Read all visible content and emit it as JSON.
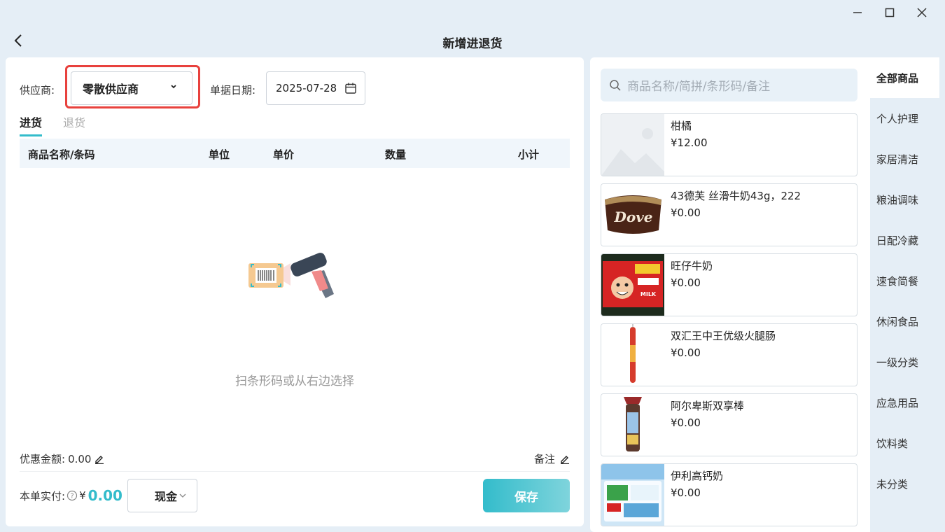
{
  "header": {
    "title": "新增进退货"
  },
  "form": {
    "supplier_label": "供应商:",
    "supplier_value": "零散供应商",
    "date_label": "单据日期:",
    "date_value": "2025-07-28"
  },
  "tabs": [
    {
      "label": "进货",
      "active": true
    },
    {
      "label": "退货",
      "active": false
    }
  ],
  "table": {
    "columns": [
      "商品名称/条码",
      "单位",
      "单价",
      "数量",
      "小计"
    ],
    "empty_text": "扫条形码或从右边选择"
  },
  "footer": {
    "discount_label": "优惠金额:",
    "discount_value": "0.00",
    "remark_label": "备注",
    "paid_label": "本单实付:",
    "currency": "¥",
    "paid_amount": "0.00",
    "payment_method": "现金",
    "save_label": "保存"
  },
  "search": {
    "placeholder": "商品名称/简拼/条形码/备注"
  },
  "products": [
    {
      "name": "柑橘",
      "price": "¥12.00"
    },
    {
      "name": "43德芙 丝滑牛奶43g，222",
      "price": "¥0.00"
    },
    {
      "name": "旺仔牛奶",
      "price": "¥0.00"
    },
    {
      "name": "双汇王中王优级火腿肠",
      "price": "¥0.00"
    },
    {
      "name": "阿尔卑斯双享棒",
      "price": "¥0.00"
    },
    {
      "name": "伊利高钙奶",
      "price": "¥0.00"
    }
  ],
  "categories": [
    {
      "label": "全部商品",
      "active": true
    },
    {
      "label": "个人护理"
    },
    {
      "label": "家居清洁"
    },
    {
      "label": "粮油调味"
    },
    {
      "label": "日配冷藏"
    },
    {
      "label": "速食简餐"
    },
    {
      "label": "休闲食品"
    },
    {
      "label": "一级分类"
    },
    {
      "label": "应急用品"
    },
    {
      "label": "饮料类"
    },
    {
      "label": "未分类"
    }
  ],
  "colors": {
    "accent": "#33bccb",
    "highlight": "#e8413d",
    "background": "#e5eef6"
  }
}
